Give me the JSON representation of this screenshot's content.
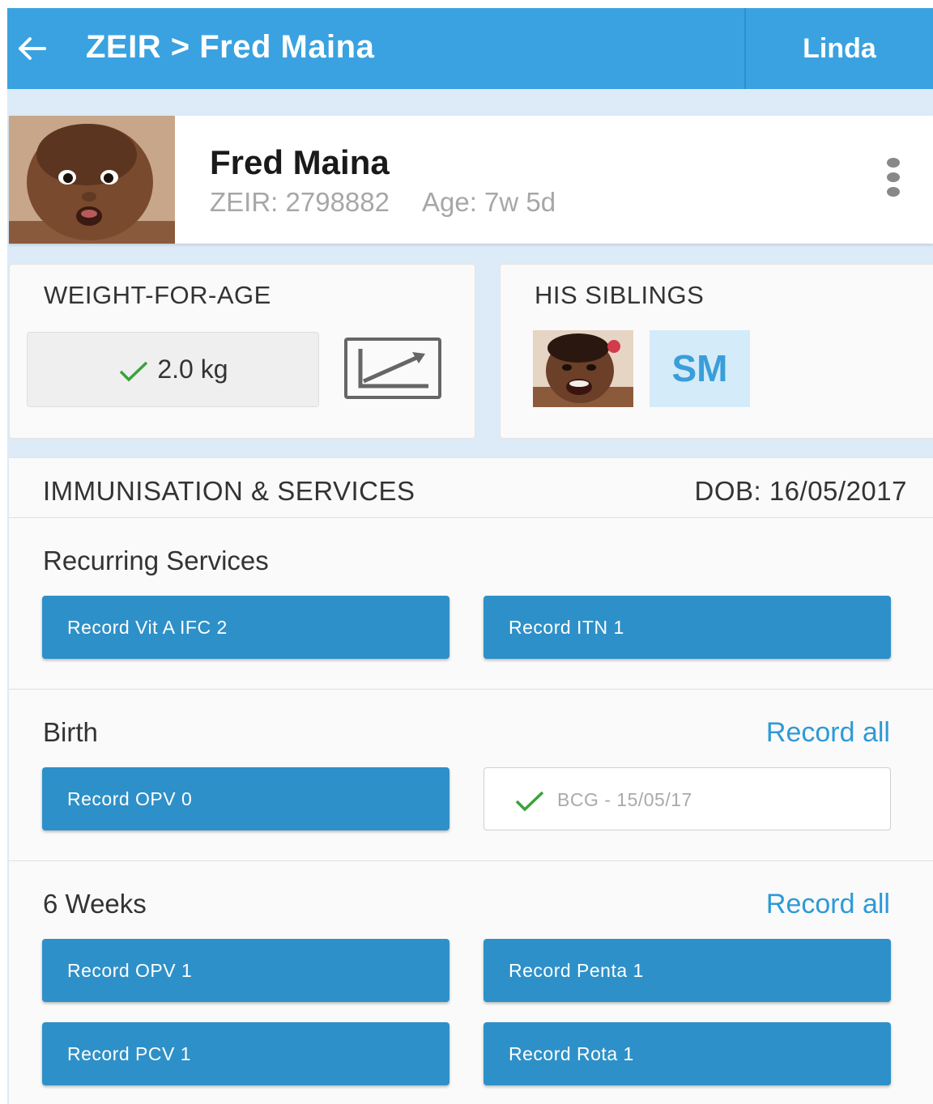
{
  "app_bar": {
    "title": "ZEIR > Fred Maina",
    "user": "Linda"
  },
  "profile": {
    "name": "Fred Maina",
    "zeir_id": "ZEIR: 2798882",
    "age": "Age: 7w 5d"
  },
  "weight_card": {
    "heading": "WEIGHT-FOR-AGE",
    "value": "2.0 kg"
  },
  "siblings_card": {
    "heading": "HIS SIBLINGS",
    "sibling_initials": "SM"
  },
  "immunisation": {
    "heading": "IMMUNISATION & SERVICES",
    "dob": "DOB: 16/05/2017",
    "sections": [
      {
        "title": "Recurring Services",
        "items": [
          "Record Vit A IFC 2",
          "Record ITN 1"
        ]
      },
      {
        "title": "Birth",
        "record_all": "Record all",
        "items": [
          "Record OPV 0",
          "BCG - 15/05/17"
        ]
      },
      {
        "title": "6 Weeks",
        "record_all": "Record all",
        "items": [
          "Record OPV 1",
          "Record Penta 1",
          "Record PCV 1",
          "Record Rota 1"
        ]
      }
    ]
  },
  "colors": {
    "app_bar": "#3aa2e0",
    "button": "#2e90c8",
    "link": "#2e9ad7",
    "check": "#3aa23a",
    "background": "#dcebf7"
  },
  "icons": [
    "back-arrow-icon",
    "more-vert-icon",
    "check-icon",
    "growth-chart-icon"
  ]
}
